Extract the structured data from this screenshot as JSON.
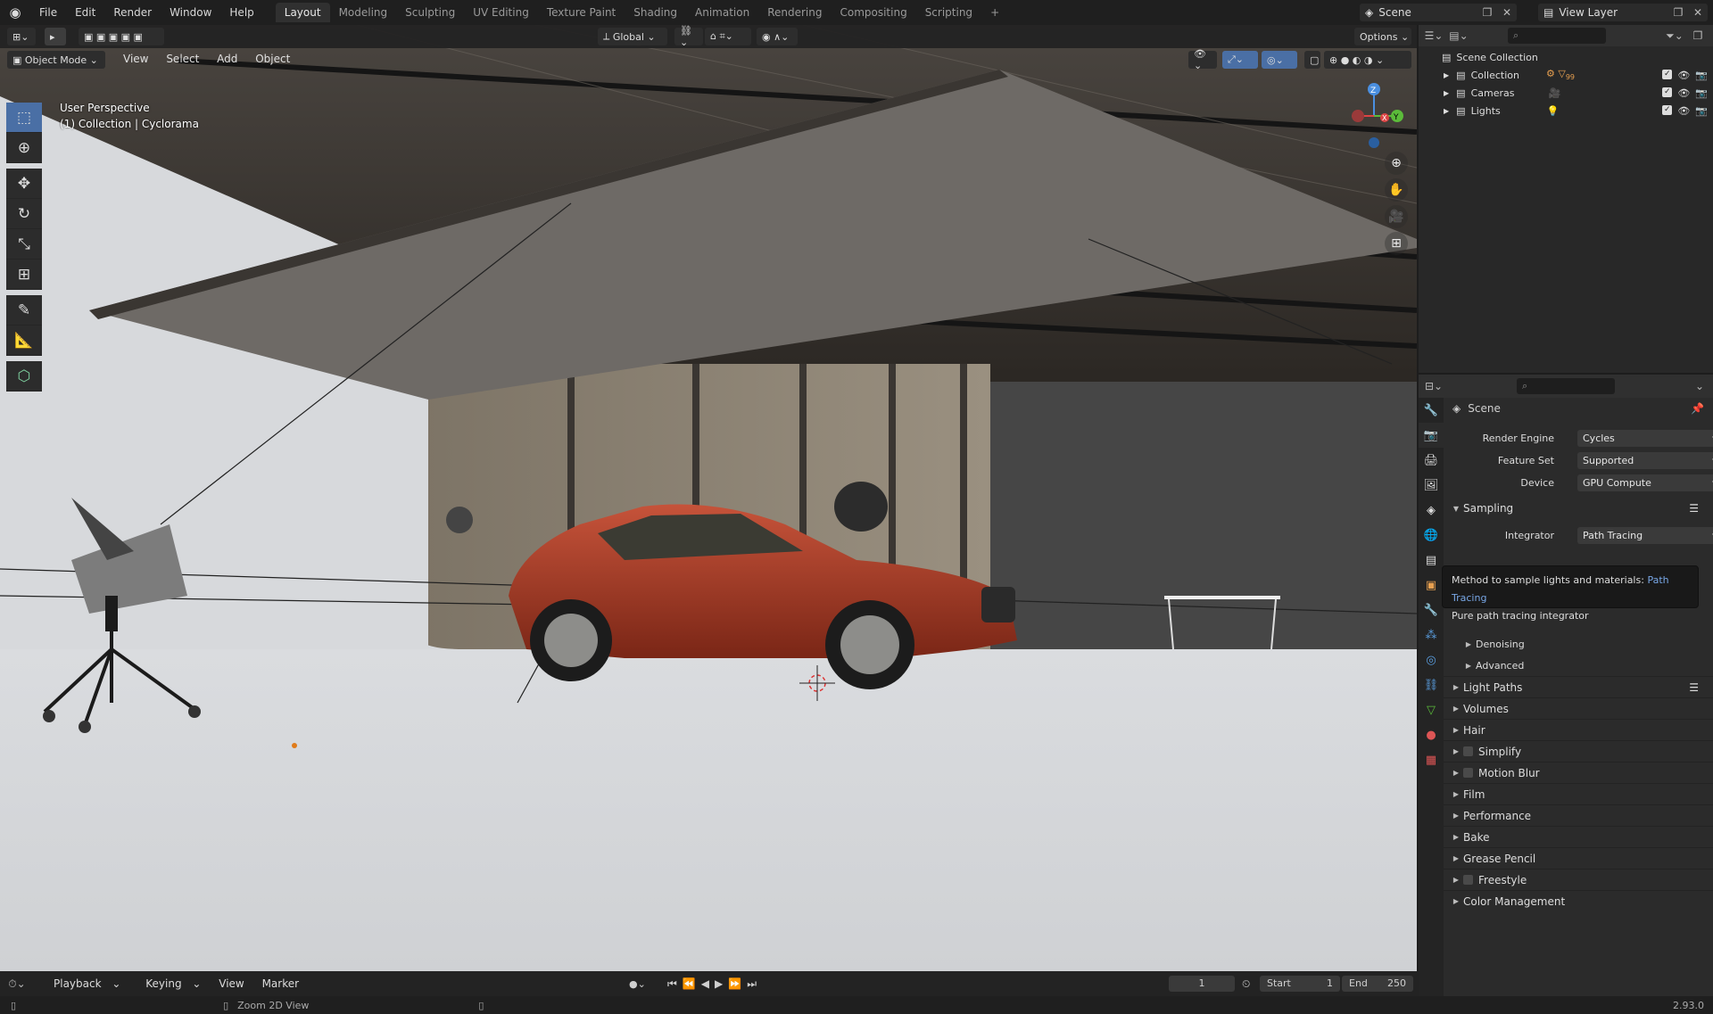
{
  "topbar": {
    "menu": [
      "File",
      "Edit",
      "Render",
      "Window",
      "Help"
    ],
    "workspaces": [
      "Layout",
      "Modeling",
      "Sculpting",
      "UV Editing",
      "Texture Paint",
      "Shading",
      "Animation",
      "Rendering",
      "Compositing",
      "Scripting"
    ],
    "active_workspace": "Layout",
    "scene": "Scene",
    "view_layer": "View Layer"
  },
  "viewport": {
    "mode": "Object Mode",
    "menu": [
      "View",
      "Select",
      "Add",
      "Object"
    ],
    "transform": "Global",
    "options": "Options",
    "info_line1": "User Perspective",
    "info_line2": "(1) Collection | Cyclorama"
  },
  "outliner": {
    "root": "Scene Collection",
    "items": [
      {
        "name": "Collection",
        "badge": "99"
      },
      {
        "name": "Cameras",
        "badge": ""
      },
      {
        "name": "Lights",
        "badge": ""
      }
    ]
  },
  "properties": {
    "context": "Scene",
    "render_engine_label": "Render Engine",
    "render_engine": "Cycles",
    "feature_set_label": "Feature Set",
    "feature_set": "Supported",
    "device_label": "Device",
    "device": "GPU Compute",
    "sampling": "Sampling",
    "integrator_label": "Integrator",
    "integrator": "Path Tracing",
    "sub_panels": [
      "Denoising",
      "Advanced"
    ],
    "panels": [
      {
        "label": "Light Paths",
        "checkbox": false,
        "list": true
      },
      {
        "label": "Volumes",
        "checkbox": false
      },
      {
        "label": "Hair",
        "checkbox": false
      },
      {
        "label": "Simplify",
        "checkbox": true
      },
      {
        "label": "Motion Blur",
        "checkbox": true
      },
      {
        "label": "Film",
        "checkbox": false
      },
      {
        "label": "Performance",
        "checkbox": false
      },
      {
        "label": "Bake",
        "checkbox": false
      },
      {
        "label": "Grease Pencil",
        "checkbox": false
      },
      {
        "label": "Freestyle",
        "checkbox": true
      },
      {
        "label": "Color Management",
        "checkbox": false
      }
    ]
  },
  "tooltip": {
    "line1": "Method to sample lights and materials:",
    "line1_value": "Path Tracing",
    "line2": "Pure path tracing integrator"
  },
  "timeline": {
    "menu": [
      "Playback",
      "Keying",
      "View",
      "Marker"
    ],
    "current_frame": "1",
    "start_label": "Start",
    "start": "1",
    "end_label": "End",
    "end": "250"
  },
  "status": {
    "hint": "Zoom 2D View",
    "version": "2.93.0"
  },
  "colors": {
    "accent": "#4a6fa5",
    "car": "#b0402a",
    "floor": "#d3d5d8"
  }
}
